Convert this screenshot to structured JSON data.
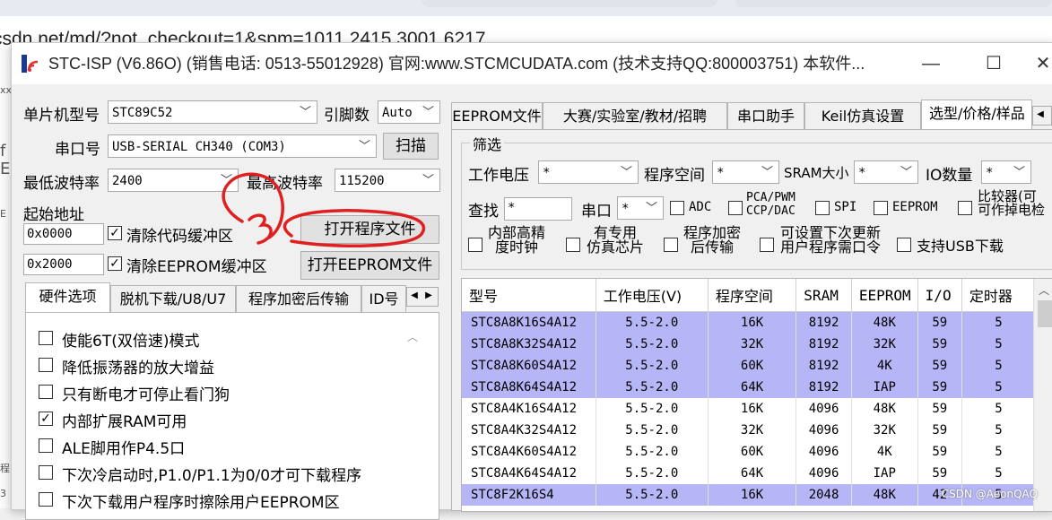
{
  "browser": {
    "url": "csdn.net/md/?not_checkout=1&spm=1011.2415.3001.6217"
  },
  "left_strip": {
    "fragments": [
      "xx",
      "f",
      "Ei",
      "E",
      "程",
      "3"
    ]
  },
  "window": {
    "title": "STC-ISP (V6.86O) (销售电话: 0513-55012928) 官网:www.STCMCUDATA.com  (技术支持QQ:800003751) 本软件...",
    "minimize": "—",
    "maximize": "☐",
    "close": "✕"
  },
  "left": {
    "mcu_label": "单片机型号",
    "mcu_value": "STC89C52",
    "pin_label": "引脚数",
    "pin_value": "Auto",
    "port_label": "串口号",
    "port_value": "USB-SERIAL CH340 (COM3)",
    "scan_button": "扫描",
    "min_baud_label": "最低波特率",
    "min_baud_value": "2400",
    "max_baud_label": "最高波特率",
    "max_baud_value": "115200",
    "start_addr_label": "起始地址",
    "addr1": "0x0000",
    "clear_code_label": "清除代码缓冲区",
    "open_file_button": "打开程序文件",
    "addr2": "0x2000",
    "clear_eeprom_label": "清除EEPROM缓冲区",
    "open_eeprom_button": "打开EEPROM文件",
    "tabs": [
      "硬件选项",
      "脱机下载/U8/U7",
      "程序加密后传输",
      "ID号"
    ],
    "options": [
      {
        "label": "使能6T(双倍速)模式",
        "checked": false
      },
      {
        "label": "降低振荡器的放大增益",
        "checked": false
      },
      {
        "label": "只有断电才可停止看门狗",
        "checked": false
      },
      {
        "label": "内部扩展RAM可用",
        "checked": true
      },
      {
        "label": "ALE脚用作P4.5口",
        "checked": false
      },
      {
        "label": "下次冷启动时,P1.0/P1.1为0/0才可下载程序",
        "checked": false
      },
      {
        "label": "下次下载用户程序时擦除用户EEPROM区",
        "checked": false
      }
    ]
  },
  "right": {
    "tabs": [
      "EEPROM文件",
      "大赛/实验室/教材/招聘",
      "串口助手",
      "Keil仿真设置",
      "选型/价格/样品"
    ],
    "filter_title": "筛选",
    "voltage_label": "工作电压",
    "voltage_value": "*",
    "program_space_label": "程序空间",
    "program_space_value": "*",
    "sram_label": "SRAM大小",
    "sram_value": "*",
    "io_label": "IO数量",
    "io_value": "*",
    "search_label": "查找",
    "search_value": "*",
    "serial_label": "串口",
    "serial_value": "*",
    "filters": [
      "ADC",
      "PCA/PWM\nCCP/DAC",
      "SPI",
      "EEPROM",
      "比较器(可\n可作掉电检"
    ],
    "filters2": [
      "内部高精\n度时钟",
      "有专用\n仿真芯片",
      "程序加密\n后传输",
      "可设置下次更新\n用户程序需口令",
      "支持USB下载"
    ],
    "table": {
      "columns": [
        "型号",
        "工作电压(V)",
        "程序空间",
        "SRAM",
        "EEPROM",
        "I/O",
        "定时器"
      ],
      "rows": [
        {
          "model": "STC8A8K16S4A12",
          "voltage": "5.5-2.0",
          "flash": "16K",
          "sram": "8192",
          "eeprom": "48K",
          "io": "59",
          "timer": "5",
          "highlight": true
        },
        {
          "model": "STC8A8K32S4A12",
          "voltage": "5.5-2.0",
          "flash": "32K",
          "sram": "8192",
          "eeprom": "32K",
          "io": "59",
          "timer": "5",
          "highlight": true
        },
        {
          "model": "STC8A8K60S4A12",
          "voltage": "5.5-2.0",
          "flash": "60K",
          "sram": "8192",
          "eeprom": "4K",
          "io": "59",
          "timer": "5",
          "highlight": true
        },
        {
          "model": "STC8A8K64S4A12",
          "voltage": "5.5-2.0",
          "flash": "64K",
          "sram": "8192",
          "eeprom": "IAP",
          "io": "59",
          "timer": "5",
          "highlight": true
        },
        {
          "model": "STC8A4K16S4A12",
          "voltage": "5.5-2.0",
          "flash": "16K",
          "sram": "4096",
          "eeprom": "48K",
          "io": "59",
          "timer": "5",
          "highlight": false
        },
        {
          "model": "STC8A4K32S4A12",
          "voltage": "5.5-2.0",
          "flash": "32K",
          "sram": "4096",
          "eeprom": "32K",
          "io": "59",
          "timer": "5",
          "highlight": false
        },
        {
          "model": "STC8A4K60S4A12",
          "voltage": "5.5-2.0",
          "flash": "60K",
          "sram": "4096",
          "eeprom": "4K",
          "io": "59",
          "timer": "5",
          "highlight": false
        },
        {
          "model": "STC8A4K64S4A12",
          "voltage": "5.5-2.0",
          "flash": "64K",
          "sram": "4096",
          "eeprom": "IAP",
          "io": "59",
          "timer": "5",
          "highlight": false
        },
        {
          "model": "STC8F2K16S4",
          "voltage": "5.5-2.0",
          "flash": "16K",
          "sram": "2048",
          "eeprom": "48K",
          "io": "42",
          "timer": "5",
          "highlight": true
        }
      ]
    }
  },
  "annotation": {
    "digit": "3",
    "color": "#e02020"
  },
  "watermark": "CSDN @AeonQAQ"
}
